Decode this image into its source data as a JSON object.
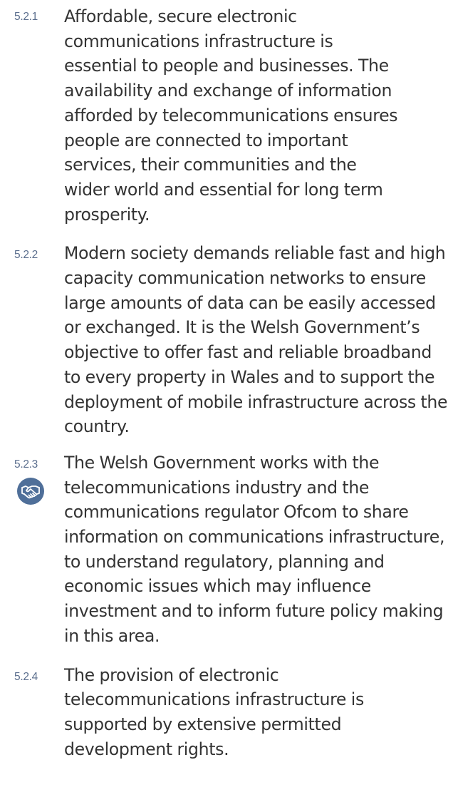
{
  "paragraphs": [
    {
      "number": "5.2.1",
      "text": "Affordable, secure electronic communications infrastructure is essential to people and businesses. The availability and exchange of information afforded by telecommunications ensures people are connected to important services, their communities and the wider world and essential for long term prosperity."
    },
    {
      "number": "5.2.2",
      "text": "Modern society demands reliable fast and high capacity communication networks to ensure large amounts of data can be easily accessed or exchanged. It is the Welsh Government’s objective to offer fast and reliable broadband to every property in Wales and to support the deployment of mobile infrastructure across the country."
    },
    {
      "number": "5.2.3",
      "text": "The Welsh Government works with the telecommunications industry and the communications regulator Ofcom to share information on communications infrastructure, to understand regulatory, planning and economic issues which may influence investment and to inform future policy making in this area.",
      "icon": "handshake-icon"
    },
    {
      "number": "5.2.4",
      "text": "The provision of electronic telecommunications infrastructure is supported by extensive permitted development rights."
    }
  ],
  "colors": {
    "number": "#5c6f8e",
    "text": "#333333",
    "icon_bg": "#4f6f99"
  }
}
